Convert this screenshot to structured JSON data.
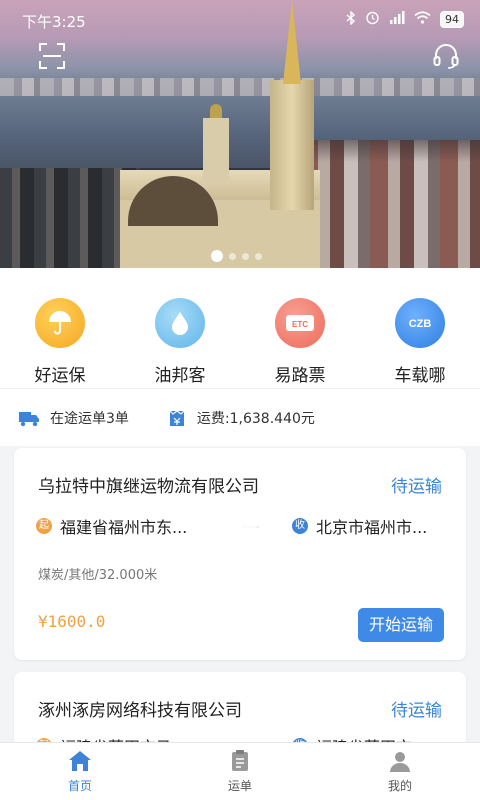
{
  "status_bar": {
    "time": "下午3:25",
    "battery": "94"
  },
  "quick_menu": [
    {
      "label": "好运保",
      "icon": "umbrella-icon",
      "color": "#f5a623"
    },
    {
      "label": "油邦客",
      "icon": "oil-drop-icon",
      "color": "#5fb4ea"
    },
    {
      "label": "易路票",
      "icon": "etc-ticket-icon",
      "color": "#ef6a5a"
    },
    {
      "label": "车载哪",
      "icon": "czb-icon",
      "color": "#2f7fe0"
    }
  ],
  "quick_icon_text": {
    "etc": "ETC",
    "czb": "CZB"
  },
  "summary": {
    "in_transit": "在途运单3单",
    "freight": "运费:1,638.440元"
  },
  "orders": [
    {
      "company": "乌拉特中旗继运物流有限公司",
      "status": "待运输",
      "start_badge": "起",
      "from": "福建省福州市东...",
      "end_badge": "收",
      "to": "北京市福州市...",
      "goods": "煤炭/其他/32.000米",
      "price": "¥1600.0",
      "action": "开始运输"
    },
    {
      "company": "涿州涿房网络科技有限公司",
      "status": "待运输",
      "start_badge": "起",
      "from": "福建省莆田市马",
      "end_badge": "收",
      "to": "福建省莆田市"
    }
  ],
  "tabbar": [
    {
      "label": "首页",
      "icon": "home-icon",
      "active": true
    },
    {
      "label": "运单",
      "icon": "waybill-icon",
      "active": false
    },
    {
      "label": "我的",
      "icon": "profile-icon",
      "active": false
    }
  ],
  "colors": {
    "accent": "#3e83d6",
    "price": "#f0a245"
  }
}
